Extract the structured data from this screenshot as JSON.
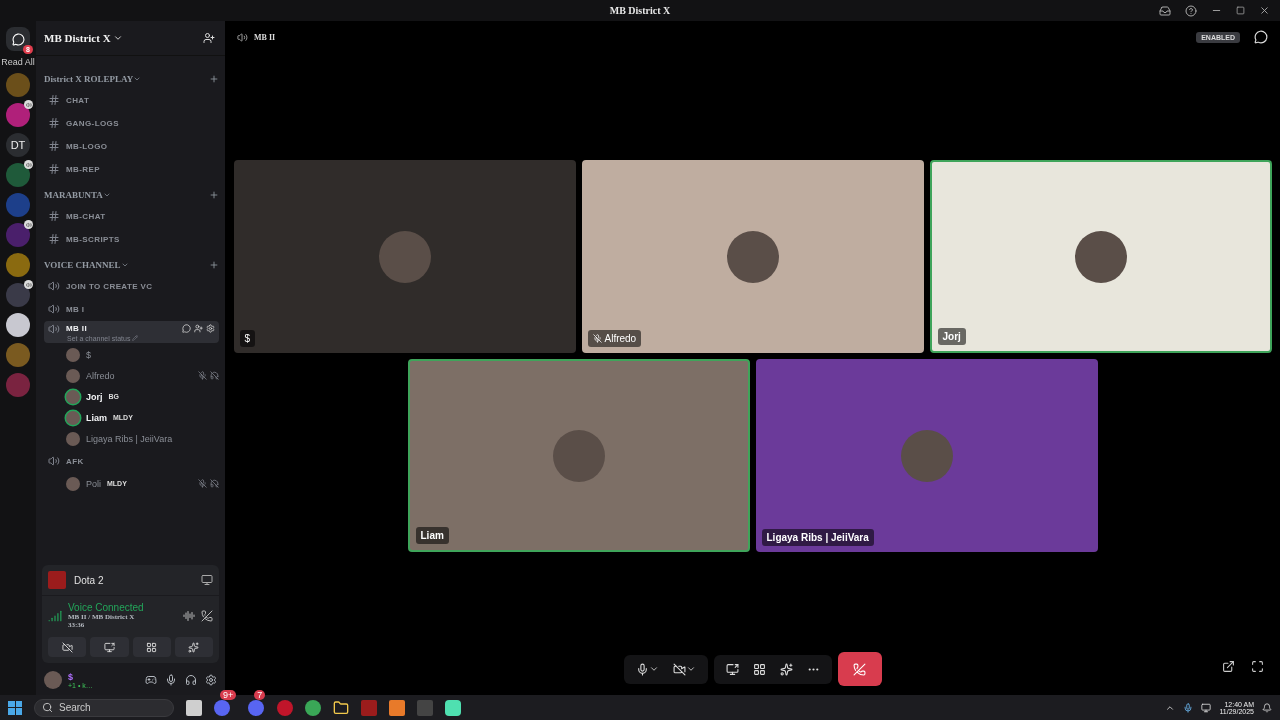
{
  "window": {
    "title": "MB District X"
  },
  "servers": {
    "read_all": "Read All",
    "home_badge": "8",
    "items": [
      {
        "kind": "icon",
        "color": "#6b4f1a",
        "speaker": false
      },
      {
        "kind": "icon",
        "color": "#b0207a",
        "speaker": true
      },
      {
        "kind": "text",
        "label": "DT",
        "color": "#2b2d31",
        "speaker": false
      },
      {
        "kind": "icon",
        "color": "#1f5a3a",
        "speaker": true
      },
      {
        "kind": "icon",
        "color": "#1d3f8a",
        "speaker": false
      },
      {
        "kind": "icon",
        "color": "#4a1f6b",
        "speaker": true
      },
      {
        "kind": "icon",
        "color": "#8a6a10",
        "speaker": false
      },
      {
        "kind": "icon",
        "color": "#3a3a48",
        "speaker": true
      },
      {
        "kind": "icon",
        "color": "#c8c8d0",
        "speaker": false
      },
      {
        "kind": "icon",
        "color": "#7a5a20",
        "speaker": false
      },
      {
        "kind": "icon",
        "color": "#7a2340",
        "speaker": false
      }
    ]
  },
  "sidebar": {
    "server_name": "MB District X",
    "categories": [
      {
        "name": "District X ROLEPLAY",
        "channels": [
          {
            "kind": "text",
            "name": "CHAT",
            "selected": false
          },
          {
            "kind": "text",
            "name": "GANG-LOGS",
            "selected": false
          },
          {
            "kind": "text",
            "name": "MB-LOGO",
            "selected": false
          },
          {
            "kind": "text",
            "name": "MB-REP",
            "selected": false
          }
        ]
      },
      {
        "name": "MARABUNTA",
        "channels": [
          {
            "kind": "text",
            "name": "MB-CHAT",
            "selected": false
          },
          {
            "kind": "text",
            "name": "MB-SCRIPTS",
            "selected": false
          }
        ]
      },
      {
        "name": "VOICE CHANNEL",
        "channels": [
          {
            "kind": "voice",
            "name": "JOIN TO CREATE VC",
            "selected": false
          },
          {
            "kind": "voice",
            "name": "MB I",
            "selected": false
          },
          {
            "kind": "voice",
            "name": "MB II",
            "selected": true,
            "status_placeholder": "Set a channel status",
            "members": [
              {
                "name": "$",
                "speaking": false,
                "muted": false
              },
              {
                "name": "Alfredo",
                "speaking": false,
                "muted": true
              },
              {
                "name": "Jorj",
                "tag": "BG",
                "speaking": true,
                "muted": false
              },
              {
                "name": "Liam",
                "tag": "MLDY",
                "speaking": true,
                "muted": false
              },
              {
                "name": "Ligaya Ribs | JeiiVara",
                "speaking": false,
                "muted": false
              }
            ]
          },
          {
            "kind": "voice",
            "name": "AFK",
            "selected": false,
            "members": [
              {
                "name": "Poli",
                "tag": "MLDY",
                "speaking": false,
                "muted": true
              }
            ]
          }
        ]
      }
    ]
  },
  "activity": {
    "game": "Dota 2"
  },
  "voice": {
    "status": "Voice Connected",
    "location": "MB II / MB District X",
    "time": "33:36"
  },
  "user": {
    "name": "$",
    "status": "+1 • k…"
  },
  "main": {
    "channel": "MB II",
    "badge": "ENABLED",
    "tiles": [
      {
        "name": "$",
        "color": "#302c2a",
        "speaking": false,
        "muted": false
      },
      {
        "name": "Alfredo",
        "color": "#bfada0",
        "speaking": false,
        "muted": true
      },
      {
        "name": "Jorj",
        "color": "#e8e6dc",
        "speaking": true,
        "muted": false
      },
      {
        "name": "Liam",
        "color": "#7d6f66",
        "speaking": true,
        "muted": false
      },
      {
        "name": "Ligaya Ribs | JeiiVara",
        "color": "#6b3a9a",
        "speaking": false,
        "muted": false
      }
    ]
  },
  "taskbar": {
    "search": {
      "placeholder": "Search"
    },
    "badges": [
      "9+",
      "7"
    ],
    "time": "12:40 AM",
    "date": "11/29/2025"
  }
}
